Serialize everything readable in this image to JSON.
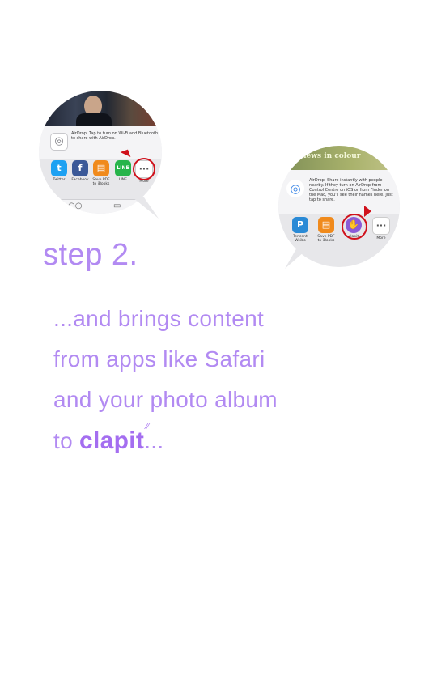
{
  "bubble_one": {
    "airdrop_text": "AirDrop. Tap to turn on Wi-Fi and Bluetooth to share with AirDrop.",
    "apps": [
      {
        "label": "Twitter",
        "glyph": "t",
        "color": "#1da1f2",
        "icon": "twitter-icon"
      },
      {
        "label": "Facebook",
        "glyph": "f",
        "color": "#3b5998",
        "icon": "facebook-icon"
      },
      {
        "label": "Save PDF to iBooks",
        "glyph": "▤",
        "color": "#f08a1c",
        "icon": "ibooks-icon"
      },
      {
        "label": "LINE",
        "glyph": "LINE",
        "color": "#27b44a",
        "icon": "line-icon"
      },
      {
        "label": "More",
        "glyph": "···",
        "color": "#ffffff",
        "icon": "more-icon"
      }
    ]
  },
  "bubble_two": {
    "banner_title": "news in colour",
    "airdrop_text": "AirDrop. Share instantly with people nearby. If they turn on AirDrop from Control Centre on iOS or from Finder on the Mac, you'll see their names here. Just tap to share.",
    "apps": [
      {
        "label": "Tencent Weibo",
        "glyph": "P",
        "color": "#2a8ad6",
        "icon": "tencent-weibo-icon"
      },
      {
        "label": "Save PDF to iBooks",
        "glyph": "▤",
        "color": "#f08a1c",
        "icon": "ibooks-icon"
      },
      {
        "label": "clapit",
        "glyph": "✋",
        "color": "#8b5bd6",
        "icon": "clapit-icon"
      },
      {
        "label": "More",
        "glyph": "···",
        "color": "#ffffff",
        "icon": "more-icon"
      }
    ]
  },
  "heading": "step 2.",
  "body": {
    "line1": "...and brings content",
    "line2": "from apps like Safari",
    "line3": "and your photo album",
    "line4_prefix": "to ",
    "brand": "clapit",
    "line4_suffix": "..."
  },
  "colors": {
    "accent": "#b28af2",
    "brand": "#a46ef0",
    "highlight_ring": "#d0111b"
  }
}
